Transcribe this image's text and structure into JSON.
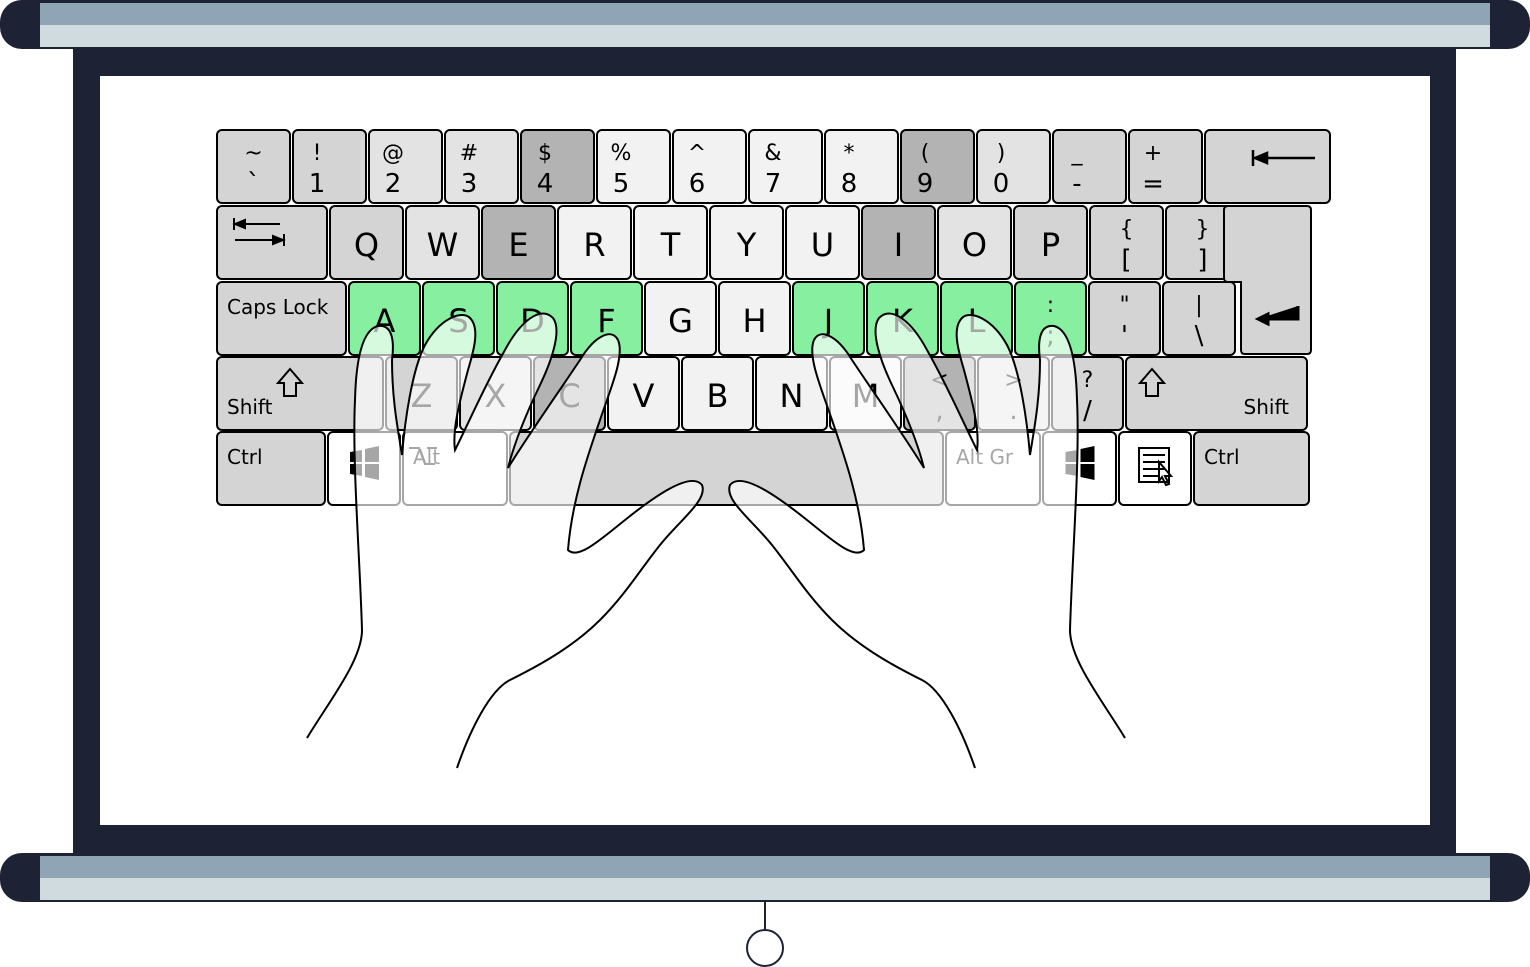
{
  "colors": {
    "frame": "#1e2235",
    "roller_top": "#8fa5b5",
    "roller_bottom": "#d0dbdf",
    "screen": "#ffffff",
    "key_dark": "#b3b3b3",
    "key_mid": "#d4d4d4",
    "key_light": "#e3e3e3",
    "key_pale": "#f2f2f2",
    "key_white": "#ffffff",
    "key_home": "#87f0a0",
    "key_stroke": "#000000"
  },
  "keyboard": {
    "rows": [
      [
        {
          "top": "~",
          "bottom": "`",
          "shade": "mid"
        },
        {
          "top": "!",
          "bottom": "1",
          "shade": "mid"
        },
        {
          "top": "@",
          "bottom": "2",
          "shade": "light"
        },
        {
          "top": "#",
          "bottom": "3",
          "shade": "light"
        },
        {
          "top": "$",
          "bottom": "4",
          "shade": "dark"
        },
        {
          "top": "%",
          "bottom": "5",
          "shade": "pale"
        },
        {
          "top": "^",
          "bottom": "6",
          "shade": "pale"
        },
        {
          "top": "&",
          "bottom": "7",
          "shade": "pale"
        },
        {
          "top": "*",
          "bottom": "8",
          "shade": "pale"
        },
        {
          "top": "(",
          "bottom": "9",
          "shade": "dark"
        },
        {
          "top": ")",
          "bottom": "0",
          "shade": "light"
        },
        {
          "top": "_",
          "bottom": "-",
          "shade": "mid"
        },
        {
          "top": "+",
          "bottom": "=",
          "shade": "mid"
        },
        {
          "icon": "backspace-icon",
          "shade": "mid"
        }
      ],
      [
        {
          "icon": "tab-icon",
          "shade": "mid"
        },
        {
          "main": "Q",
          "shade": "mid"
        },
        {
          "main": "W",
          "shade": "light"
        },
        {
          "main": "E",
          "shade": "dark"
        },
        {
          "main": "R",
          "shade": "pale"
        },
        {
          "main": "T",
          "shade": "pale"
        },
        {
          "main": "Y",
          "shade": "pale"
        },
        {
          "main": "U",
          "shade": "pale"
        },
        {
          "main": "I",
          "shade": "dark"
        },
        {
          "main": "O",
          "shade": "light"
        },
        {
          "main": "P",
          "shade": "mid"
        },
        {
          "top": "{",
          "bottom": "[",
          "shade": "mid"
        },
        {
          "top": "}",
          "bottom": "]",
          "shade": "mid"
        }
      ],
      [
        {
          "text": "Caps Lock",
          "shade": "mid"
        },
        {
          "main": "A",
          "shade": "home"
        },
        {
          "main": "S",
          "shade": "home"
        },
        {
          "main": "D",
          "shade": "home"
        },
        {
          "main": "F",
          "shade": "home"
        },
        {
          "main": "G",
          "shade": "pale"
        },
        {
          "main": "H",
          "shade": "pale"
        },
        {
          "main": "J",
          "shade": "home"
        },
        {
          "main": "K",
          "shade": "home"
        },
        {
          "main": "L",
          "shade": "home"
        },
        {
          "top": ":",
          "bottom": ";",
          "shade": "home"
        },
        {
          "top": "\"",
          "bottom": "'",
          "shade": "mid"
        },
        {
          "top": "|",
          "bottom": "\\",
          "shade": "mid"
        },
        {
          "icon": "enter-icon",
          "shade": "mid"
        }
      ],
      [
        {
          "text": "Shift",
          "icon": "shift-icon",
          "shade": "mid"
        },
        {
          "main": "Z",
          "shade": "mid"
        },
        {
          "main": "X",
          "shade": "light"
        },
        {
          "main": "C",
          "shade": "dark"
        },
        {
          "main": "V",
          "shade": "pale"
        },
        {
          "main": "B",
          "shade": "pale"
        },
        {
          "main": "N",
          "shade": "pale"
        },
        {
          "main": "M",
          "shade": "pale"
        },
        {
          "top": "<",
          "bottom": ",",
          "shade": "dark"
        },
        {
          "top": ">",
          "bottom": ".",
          "shade": "light"
        },
        {
          "top": "?",
          "bottom": "/",
          "shade": "mid"
        },
        {
          "text": "Shift",
          "icon": "shift-icon",
          "shade": "mid"
        }
      ],
      [
        {
          "text": "Ctrl",
          "shade": "mid"
        },
        {
          "icon": "windows-icon",
          "shade": "white"
        },
        {
          "text": "Alt",
          "icon": "option-icon",
          "shade": "white"
        },
        {
          "icon": "space-bar",
          "shade": "mid"
        },
        {
          "text": "Alt Gr",
          "shade": "white"
        },
        {
          "icon": "windows-icon",
          "shade": "white"
        },
        {
          "icon": "menu-icon",
          "shade": "white"
        },
        {
          "text": "Ctrl",
          "shade": "mid"
        }
      ]
    ]
  }
}
